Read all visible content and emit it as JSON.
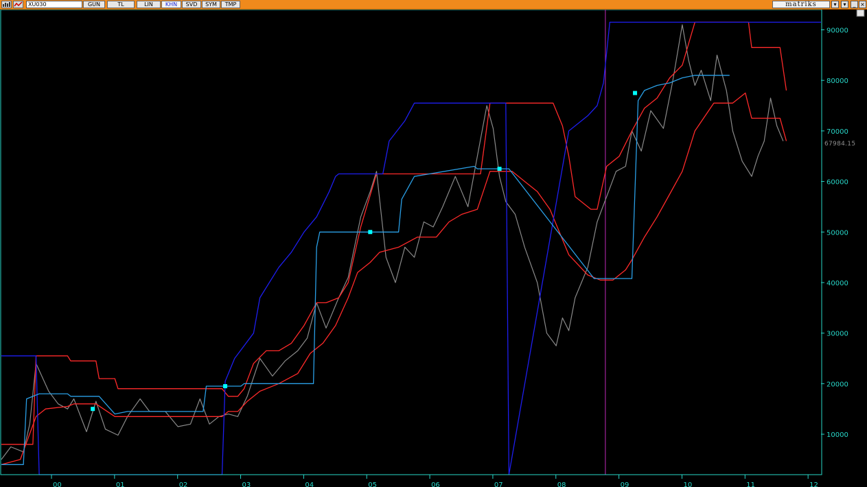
{
  "toolbar": {
    "symbol": "XU030",
    "buttons": [
      {
        "label": "GUN",
        "active": false
      },
      {
        "label": "TL",
        "active": false
      },
      {
        "label": "LIN",
        "active": false
      },
      {
        "label": "KHN",
        "active": true
      },
      {
        "label": "SVD",
        "active": false
      },
      {
        "label": "SYM",
        "active": false
      },
      {
        "label": "TMP",
        "active": false
      }
    ],
    "brand": "matriks",
    "icons": [
      "chart-type-icon",
      "indicator-icon",
      "dropdown-icon",
      "extra-dropdown-icon",
      "minimize-icon",
      "restore-icon",
      "close-icon"
    ]
  },
  "colors": {
    "background": "#000000",
    "toolbar": "#f08a1c",
    "axis": "#28d7c9",
    "price": "#8a8a8a",
    "channel_red": "#ff2a2a",
    "channel_blue": "#1e1ef0",
    "channel_light_blue": "#2a9fe6",
    "signal": "#00ffff",
    "marker": "#c02ab8"
  },
  "chart_data": {
    "type": "line",
    "y_axis_position": "right",
    "ylim": [
      2000,
      94000
    ],
    "yticks": [
      10000,
      20000,
      30000,
      40000,
      50000,
      60000,
      70000,
      80000,
      90000
    ],
    "ytick_labels": [
      "10000",
      "20000",
      "30000",
      "40000",
      "50000",
      "60000",
      "70000",
      "80000",
      "90000"
    ],
    "x_range": [
      2000.0,
      2013.0
    ],
    "xticks": [
      2000,
      2001,
      2002,
      2003,
      2004,
      2005,
      2006,
      2007,
      2008,
      2009,
      2010,
      2011,
      2012
    ],
    "xtick_labels": [
      "00",
      "01",
      "02",
      "03",
      "04",
      "05",
      "06",
      "07",
      "08",
      "09",
      "10",
      "11",
      "12"
    ],
    "last_price_label": "67984.15",
    "last_price": 67984.15,
    "vertical_marker_x": 2009.58,
    "grid": false,
    "series": [
      {
        "role": "price",
        "x": [
          2000.0,
          2000.15,
          2000.35,
          2000.45,
          2000.55,
          2000.75,
          2000.9,
          2001.05,
          2001.15,
          2001.35,
          2001.5,
          2001.65,
          2001.85,
          2002.0,
          2002.2,
          2002.35,
          2002.6,
          2002.8,
          2003.0,
          2003.15,
          2003.3,
          2003.45,
          2003.6,
          2003.75,
          2003.9,
          2004.1,
          2004.3,
          2004.5,
          2004.7,
          2004.85,
          2005.0,
          2005.15,
          2005.35,
          2005.5,
          2005.7,
          2005.85,
          2005.95,
          2006.1,
          2006.25,
          2006.4,
          2006.55,
          2006.7,
          2006.85,
          2007.0,
          2007.2,
          2007.4,
          2007.55,
          2007.7,
          2007.8,
          2007.9,
          2008.0,
          2008.15,
          2008.3,
          2008.5,
          2008.65,
          2008.8,
          2008.9,
          2009.0,
          2009.1,
          2009.2,
          2009.3,
          2009.45,
          2009.6,
          2009.75,
          2009.9,
          2010.0,
          2010.15,
          2010.3,
          2010.5,
          2010.65,
          2010.8,
          2010.9,
          2011.0,
          2011.1,
          2011.25,
          2011.35,
          2011.5,
          2011.6,
          2011.75,
          2011.9,
          2012.0,
          2012.1,
          2012.2,
          2012.3,
          2012.4
        ],
        "y": [
          5000,
          7500,
          6500,
          12000,
          24000,
          18500,
          16000,
          15000,
          17000,
          10500,
          16500,
          11000,
          9800,
          13500,
          17000,
          14500,
          14500,
          11500,
          12000,
          17000,
          12000,
          13500,
          14000,
          13500,
          17500,
          25000,
          21500,
          24500,
          26500,
          29000,
          36000,
          31000,
          37000,
          41000,
          53000,
          58000,
          62000,
          45000,
          40000,
          47000,
          45000,
          52000,
          51000,
          55000,
          61000,
          55000,
          65000,
          75000,
          70500,
          61000,
          56000,
          53500,
          47000,
          40000,
          30000,
          27500,
          33000,
          30500,
          37000,
          40000,
          43000,
          52000,
          57000,
          62000,
          63000,
          70000,
          66000,
          74000,
          70500,
          80000,
          91000,
          84000,
          79000,
          82000,
          76000,
          85000,
          78000,
          70000,
          64000,
          61000,
          65000,
          68000,
          76500,
          71000,
          67984
        ]
      },
      {
        "role": "upper_channel_red",
        "x": [
          2000.0,
          2000.5,
          2000.55,
          2001.05,
          2001.1,
          2001.5,
          2001.55,
          2001.8,
          2001.85,
          2003.5,
          2003.6,
          2003.75,
          2003.85,
          2004.0,
          2004.2,
          2004.4,
          2004.6,
          2004.8,
          2005.0,
          2005.15,
          2005.35,
          2005.5,
          2005.7,
          2005.95,
          2007.6,
          2007.75,
          2008.75,
          2008.9,
          2009.0,
          2009.1,
          2009.35,
          2009.45,
          2009.6,
          2009.8,
          2010.0,
          2010.2,
          2010.4,
          2010.6,
          2010.8,
          2011.0,
          2011.85,
          2011.9,
          2012.35,
          2012.45
        ],
        "y": [
          8000,
          8000,
          25500,
          25500,
          24500,
          24500,
          21000,
          21000,
          19000,
          19000,
          17500,
          17500,
          19000,
          24000,
          26500,
          26500,
          28000,
          31500,
          36000,
          36000,
          37000,
          40000,
          51000,
          61500,
          61500,
          75500,
          75500,
          71000,
          65000,
          57000,
          54500,
          54500,
          63000,
          65000,
          70000,
          74500,
          76500,
          80500,
          83000,
          91500,
          91500,
          86500,
          86500,
          78000
        ]
      },
      {
        "role": "lower_channel_red",
        "x": [
          2000.0,
          2000.3,
          2000.55,
          2000.7,
          2001.05,
          2001.15,
          2001.5,
          2001.8,
          2001.85,
          2003.5,
          2003.6,
          2003.75,
          2003.9,
          2004.1,
          2004.4,
          2004.7,
          2004.9,
          2005.1,
          2005.3,
          2005.5,
          2005.65,
          2005.85,
          2006.0,
          2006.3,
          2006.6,
          2006.9,
          2007.1,
          2007.3,
          2007.55,
          2007.75,
          2008.1,
          2008.5,
          2008.7,
          2009.0,
          2009.3,
          2009.5,
          2009.7,
          2009.9,
          2010.0,
          2010.2,
          2010.4,
          2010.6,
          2010.8,
          2011.0,
          2011.3,
          2011.6,
          2011.8,
          2011.9,
          2012.35,
          2012.45
        ],
        "y": [
          4000,
          5000,
          13500,
          15000,
          15500,
          16000,
          16000,
          13500,
          13500,
          13500,
          14500,
          14500,
          16500,
          18500,
          20000,
          22000,
          26000,
          28000,
          31500,
          37000,
          42000,
          44000,
          46000,
          47000,
          49000,
          49000,
          52000,
          53500,
          54500,
          62000,
          62000,
          58000,
          54500,
          45500,
          41500,
          40500,
          40500,
          42500,
          44500,
          49000,
          53000,
          57500,
          62000,
          70000,
          75500,
          75500,
          77500,
          72500,
          72500,
          68000
        ]
      },
      {
        "role": "upper_channel_blue",
        "x": [
          2000.0,
          2000.55,
          2000.6,
          2003.5,
          2003.55,
          2003.7,
          2004.0,
          2004.1,
          2004.4,
          2004.6,
          2004.8,
          2005.0,
          2005.2,
          2005.3,
          2005.35,
          2006.05,
          2006.15,
          2006.4,
          2006.55,
          2008.0,
          2008.05,
          2009.0,
          2009.3,
          2009.45,
          2009.55,
          2009.65,
          2009.8,
          2010.1,
          2010.4,
          2010.6,
          2010.9,
          2013.0
        ],
        "y": [
          25500,
          25500,
          2000,
          2000,
          20500,
          25000,
          30000,
          37000,
          43000,
          46000,
          50000,
          53000,
          58000,
          61000,
          61500,
          61500,
          68000,
          72000,
          75500,
          75500,
          2000,
          70000,
          73000,
          75000,
          79500,
          91500,
          91500,
          91500,
          91500,
          91500,
          91500,
          91500
        ]
      },
      {
        "role": "signal_channel_light_blue",
        "x": [
          2000.0,
          2000.35,
          2000.4,
          2000.6,
          2001.05,
          2001.1,
          2001.55,
          2001.8,
          2002.0,
          2003.2,
          2003.25,
          2003.35,
          2003.8,
          2003.85,
          2004.95,
          2005.0,
          2005.05,
          2005.15,
          2005.35,
          2006.0,
          2006.3,
          2006.35,
          2006.55,
          2007.5,
          2007.55,
          2008.05,
          2009.4,
          2009.5,
          2009.85,
          2010.0,
          2010.1,
          2010.2,
          2010.4,
          2010.6,
          2010.8,
          2011.0,
          2011.3,
          2011.5,
          2011.55
        ],
        "y": [
          4000,
          4000,
          17000,
          18000,
          18000,
          17500,
          17500,
          14000,
          14500,
          14500,
          19500,
          19500,
          19500,
          20000,
          20000,
          47000,
          50000,
          50000,
          50000,
          50000,
          50000,
          56500,
          61000,
          63000,
          62500,
          62500,
          40800,
          40800,
          40800,
          40800,
          76000,
          78000,
          79000,
          79500,
          80500,
          81000,
          81000,
          81000,
          81000
        ]
      },
      {
        "role": "signal_points",
        "x": [
          2001.45,
          2003.55,
          2005.85,
          2007.9,
          2010.05
        ],
        "y": [
          15000,
          19500,
          50000,
          62500,
          77500
        ]
      }
    ]
  }
}
